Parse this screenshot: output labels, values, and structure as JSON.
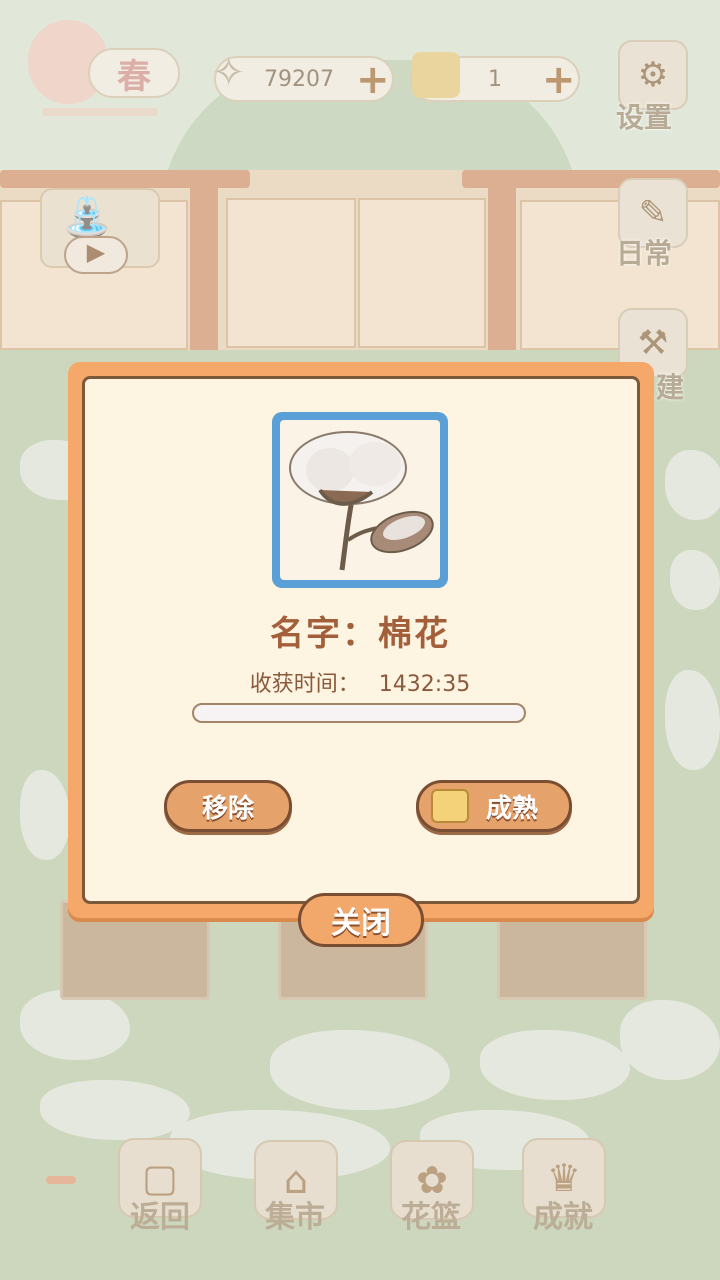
{
  "hud": {
    "season": "春",
    "fish_count": "79207",
    "cheese_count": "1",
    "settings_label": "设置",
    "daily_label": "日常",
    "build_label": "建"
  },
  "dialog": {
    "name_line": "名字：棉花",
    "harvest_label": "收获时间：",
    "harvest_time": "1432:35",
    "progress": 0,
    "remove_label": "移除",
    "mature_label": "成熟",
    "close_label": "关闭",
    "item_icon": "cotton-plant-icon"
  },
  "bottom_nav": {
    "back": "返回",
    "market": "集市",
    "basket": "花篮",
    "achievements": "成就"
  },
  "colors": {
    "dialog_border": "#f5a86a",
    "dialog_bg": "#fdf4e2",
    "button": "#e6a26b",
    "item_frame": "#5aa0d6",
    "text_brown": "#a35f3a"
  }
}
